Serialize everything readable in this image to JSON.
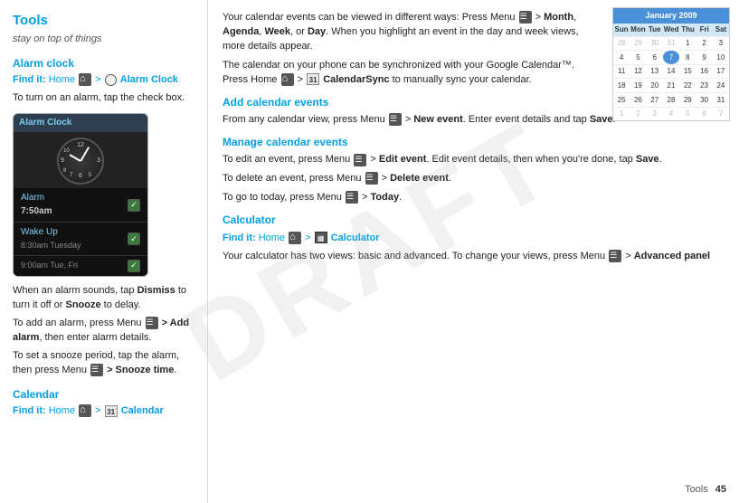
{
  "page": {
    "title": "Tools",
    "subtitle": "stay on top of things",
    "draft_watermark": "DRAFT"
  },
  "left": {
    "alarm_clock": {
      "heading": "Alarm clock",
      "find_it_prefix": "Find it:",
      "find_it_text": "Home",
      "find_it_icon": "home",
      "find_it_separator": " > ",
      "find_it_icon2": "alarmclock",
      "find_it_bold": "Alarm Clock",
      "para1": "To turn on an alarm, tap the check box.",
      "para2": "When an alarm sounds, tap ",
      "para2_bold1": "Dismiss",
      "para2_mid": " to turn it off or ",
      "para2_bold2": "Snooze",
      "para2_end": " to delay.",
      "para3_start": "To add an alarm, press Menu ",
      "para3_bold": "> Add alarm",
      "para3_end": ", then enter alarm details.",
      "para4_start": "To set a snooze period, tap the alarm, then press Menu ",
      "para4_bold": "> Snooze time",
      "para4_end": ".",
      "phone_header": "Alarm Clock",
      "alarms": [
        {
          "name": "Alarm",
          "time": "7:50am",
          "checked": true
        },
        {
          "name": "Wake Up",
          "sub": "8:30am Tuesday",
          "checked": true
        },
        {
          "name": "",
          "sub": "9:00am Tue, Fri",
          "checked": true
        }
      ]
    },
    "calendar": {
      "heading": "Calendar",
      "find_it_prefix": "Find it:",
      "find_it_text": "Home",
      "find_it_separator": " > ",
      "find_it_bold": "Calendar"
    }
  },
  "right": {
    "intro": "Your calendar events can be viewed in different ways: Press Menu",
    "intro_bold1": "Month",
    "intro_mid": ", ",
    "intro_bold2": "Agenda",
    "intro_comma": ", ",
    "intro_bold3": "Week",
    "intro_or": ", or ",
    "intro_bold4": "Day",
    "intro_end": ". When you highlight an event in the day and week views, more details appear.",
    "sync_text": "The calendar on your phone can be synchronized with your Google Calendar™. Press Home",
    "sync_mid": " > ",
    "sync_icon": "calendar-sync",
    "sync_bold": "CalendarSync",
    "sync_end": " to manually sync your calendar.",
    "add_events": {
      "heading": "Add calendar events",
      "text": "From any calendar view, press Menu",
      "bold": "> New event",
      "end": ". Enter event details and tap",
      "save_bold": "Save",
      "end2": "."
    },
    "manage_events": {
      "heading": "Manage calendar events",
      "edit_text": "To edit an event, press Menu",
      "edit_bold": "> Edit event",
      "edit_end": ". Edit event details, then when you're done, tap",
      "edit_save": "Save",
      "edit_end2": ".",
      "delete_text": "To delete an event, press Menu",
      "delete_bold": "> Delete event",
      "delete_end": ".",
      "today_text": "To go to today, press Menu",
      "today_bold": "> Today",
      "today_end": "."
    },
    "calculator": {
      "heading": "Calculator",
      "find_it_prefix": "Find it:",
      "find_it_text": "Home",
      "find_it_separator": " > ",
      "find_it_bold": "Calculator",
      "text": "Your calculator has two views: basic and advanced. To change your views, press Menu",
      "bold": "> Advanced panel"
    }
  },
  "calendar_mini": {
    "header": "January 2009",
    "day_names": [
      "Sun",
      "Mon",
      "Tue",
      "Wed",
      "Thu",
      "Fri",
      "Sat"
    ],
    "weeks": [
      [
        "28",
        "29",
        "30",
        "31",
        "1",
        "2",
        "3"
      ],
      [
        "4",
        "5",
        "6",
        "7",
        "8",
        "9",
        "10"
      ],
      [
        "11",
        "12",
        "13",
        "14",
        "15",
        "16",
        "17"
      ],
      [
        "18",
        "19",
        "20",
        "21",
        "22",
        "23",
        "24"
      ],
      [
        "25",
        "26",
        "27",
        "28",
        "29",
        "30",
        "31"
      ],
      [
        "1",
        "2",
        "3",
        "4",
        "5",
        "6",
        "7"
      ]
    ],
    "other_month_first_row": [
      0,
      1,
      2,
      3
    ],
    "other_month_last_row": [
      0,
      1,
      2,
      3,
      4,
      5,
      6
    ],
    "today_week": 1,
    "today_day": 5
  },
  "footer": {
    "label": "Tools",
    "page": "45"
  }
}
